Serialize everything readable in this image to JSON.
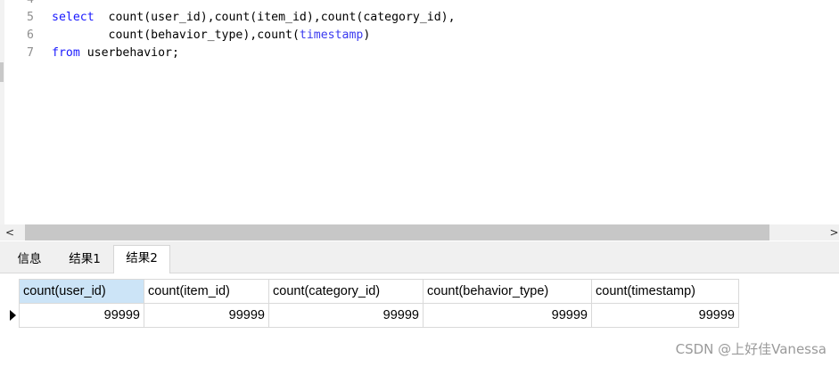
{
  "editor": {
    "lines": [
      {
        "number": "4",
        "parts": []
      },
      {
        "number": "5",
        "parts": [
          {
            "text": "select",
            "cls": "kw"
          },
          {
            "text": "  count(user_id),count(item_id),count(category_id),",
            "cls": "tx"
          }
        ]
      },
      {
        "number": "6",
        "parts": [
          {
            "text": "        count(behavior_type),count(",
            "cls": "tx"
          },
          {
            "text": "timestamp",
            "cls": "fn"
          },
          {
            "text": ")",
            "cls": "tx"
          }
        ]
      },
      {
        "number": "7",
        "parts": [
          {
            "text": "from",
            "cls": "kw"
          },
          {
            "text": " userbehavior;",
            "cls": "tx"
          }
        ]
      }
    ]
  },
  "scrollbar": {
    "left_arrow": "<",
    "right_arrow": ">"
  },
  "tabs": [
    {
      "label": "信息",
      "active": false
    },
    {
      "label": "结果1",
      "active": false
    },
    {
      "label": "结果2",
      "active": true
    }
  ],
  "results": {
    "columns": [
      "count(user_id)",
      "count(item_id)",
      "count(category_id)",
      "count(behavior_type)",
      "count(timestamp)"
    ],
    "rows": [
      [
        "99999",
        "99999",
        "99999",
        "99999",
        "99999"
      ]
    ]
  },
  "watermark": "CSDN @上好佳Vanessa",
  "colors": {
    "keyword": "#1a1aff",
    "active_header": "#cce4f7",
    "tab_bar": "#f0f0f0"
  }
}
